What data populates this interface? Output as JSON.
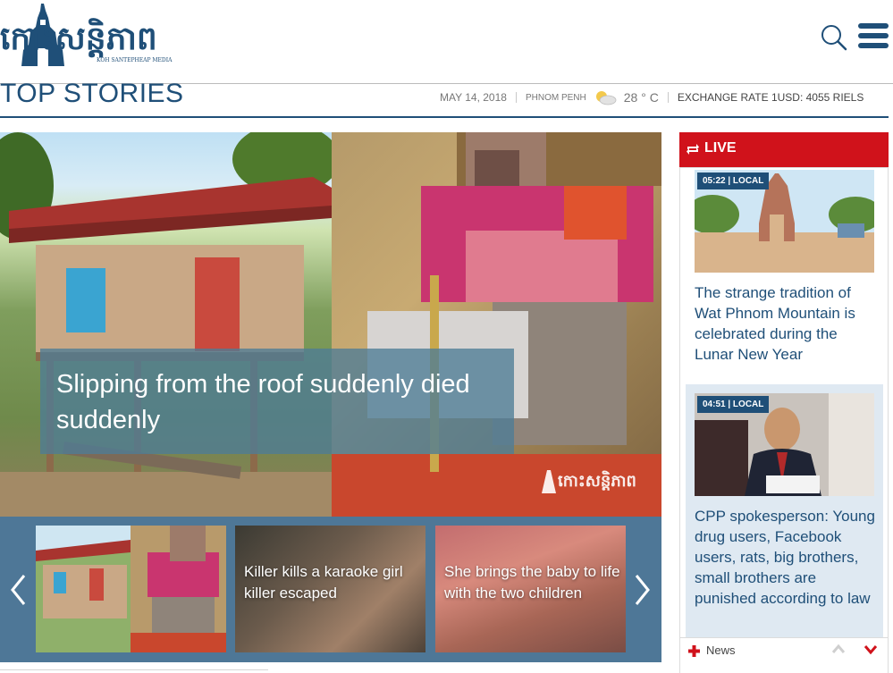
{
  "brand": {
    "logo_text": "កោះសន្តិភាព",
    "logo_subtext": "KOH SANTEPHEAP MEDIA",
    "logo_icon": "temple-tower-icon",
    "color": "#1f4f78"
  },
  "header": {
    "search_icon": "search-icon",
    "menu_icon": "hamburger-menu-icon"
  },
  "section": {
    "title": "TOP STORIES"
  },
  "meta": {
    "date": "MAY 14, 2018",
    "city": "PHNOM PENH",
    "weather_icon": "partly-cloudy-icon",
    "temperature": "28 ° C",
    "exchange": "EXCHANGE RATE 1USD: 4055 RIELS"
  },
  "hero": {
    "title": "Slipping from the roof suddenly died suddenly",
    "watermark_text": "កោះសន្តិភាព"
  },
  "carousel": {
    "prev_icon": "chevron-left-icon",
    "next_icon": "chevron-right-icon",
    "items": [
      {
        "title": ""
      },
      {
        "title": "Killer kills a karaoke girl killer escaped"
      },
      {
        "title": "She brings the baby to life with the two children"
      }
    ]
  },
  "live": {
    "label": "LIVE",
    "icon": "repeat-icon",
    "accent": "#d0121b",
    "items": [
      {
        "badge": "05:22 | LOCAL",
        "title": "The strange tradition of Wat Phnom Mountain is celebrated during the Lunar New Year"
      },
      {
        "badge": "04:51 | LOCAL",
        "title": "CPP spokesperson: Young drug users, Facebook users, rats, big brothers, small brothers are punished according to law"
      }
    ],
    "footer": {
      "label": "News",
      "news_icon": "red-cross-icon",
      "up_icon": "chevron-up-icon",
      "down_icon": "chevron-down-icon"
    }
  }
}
